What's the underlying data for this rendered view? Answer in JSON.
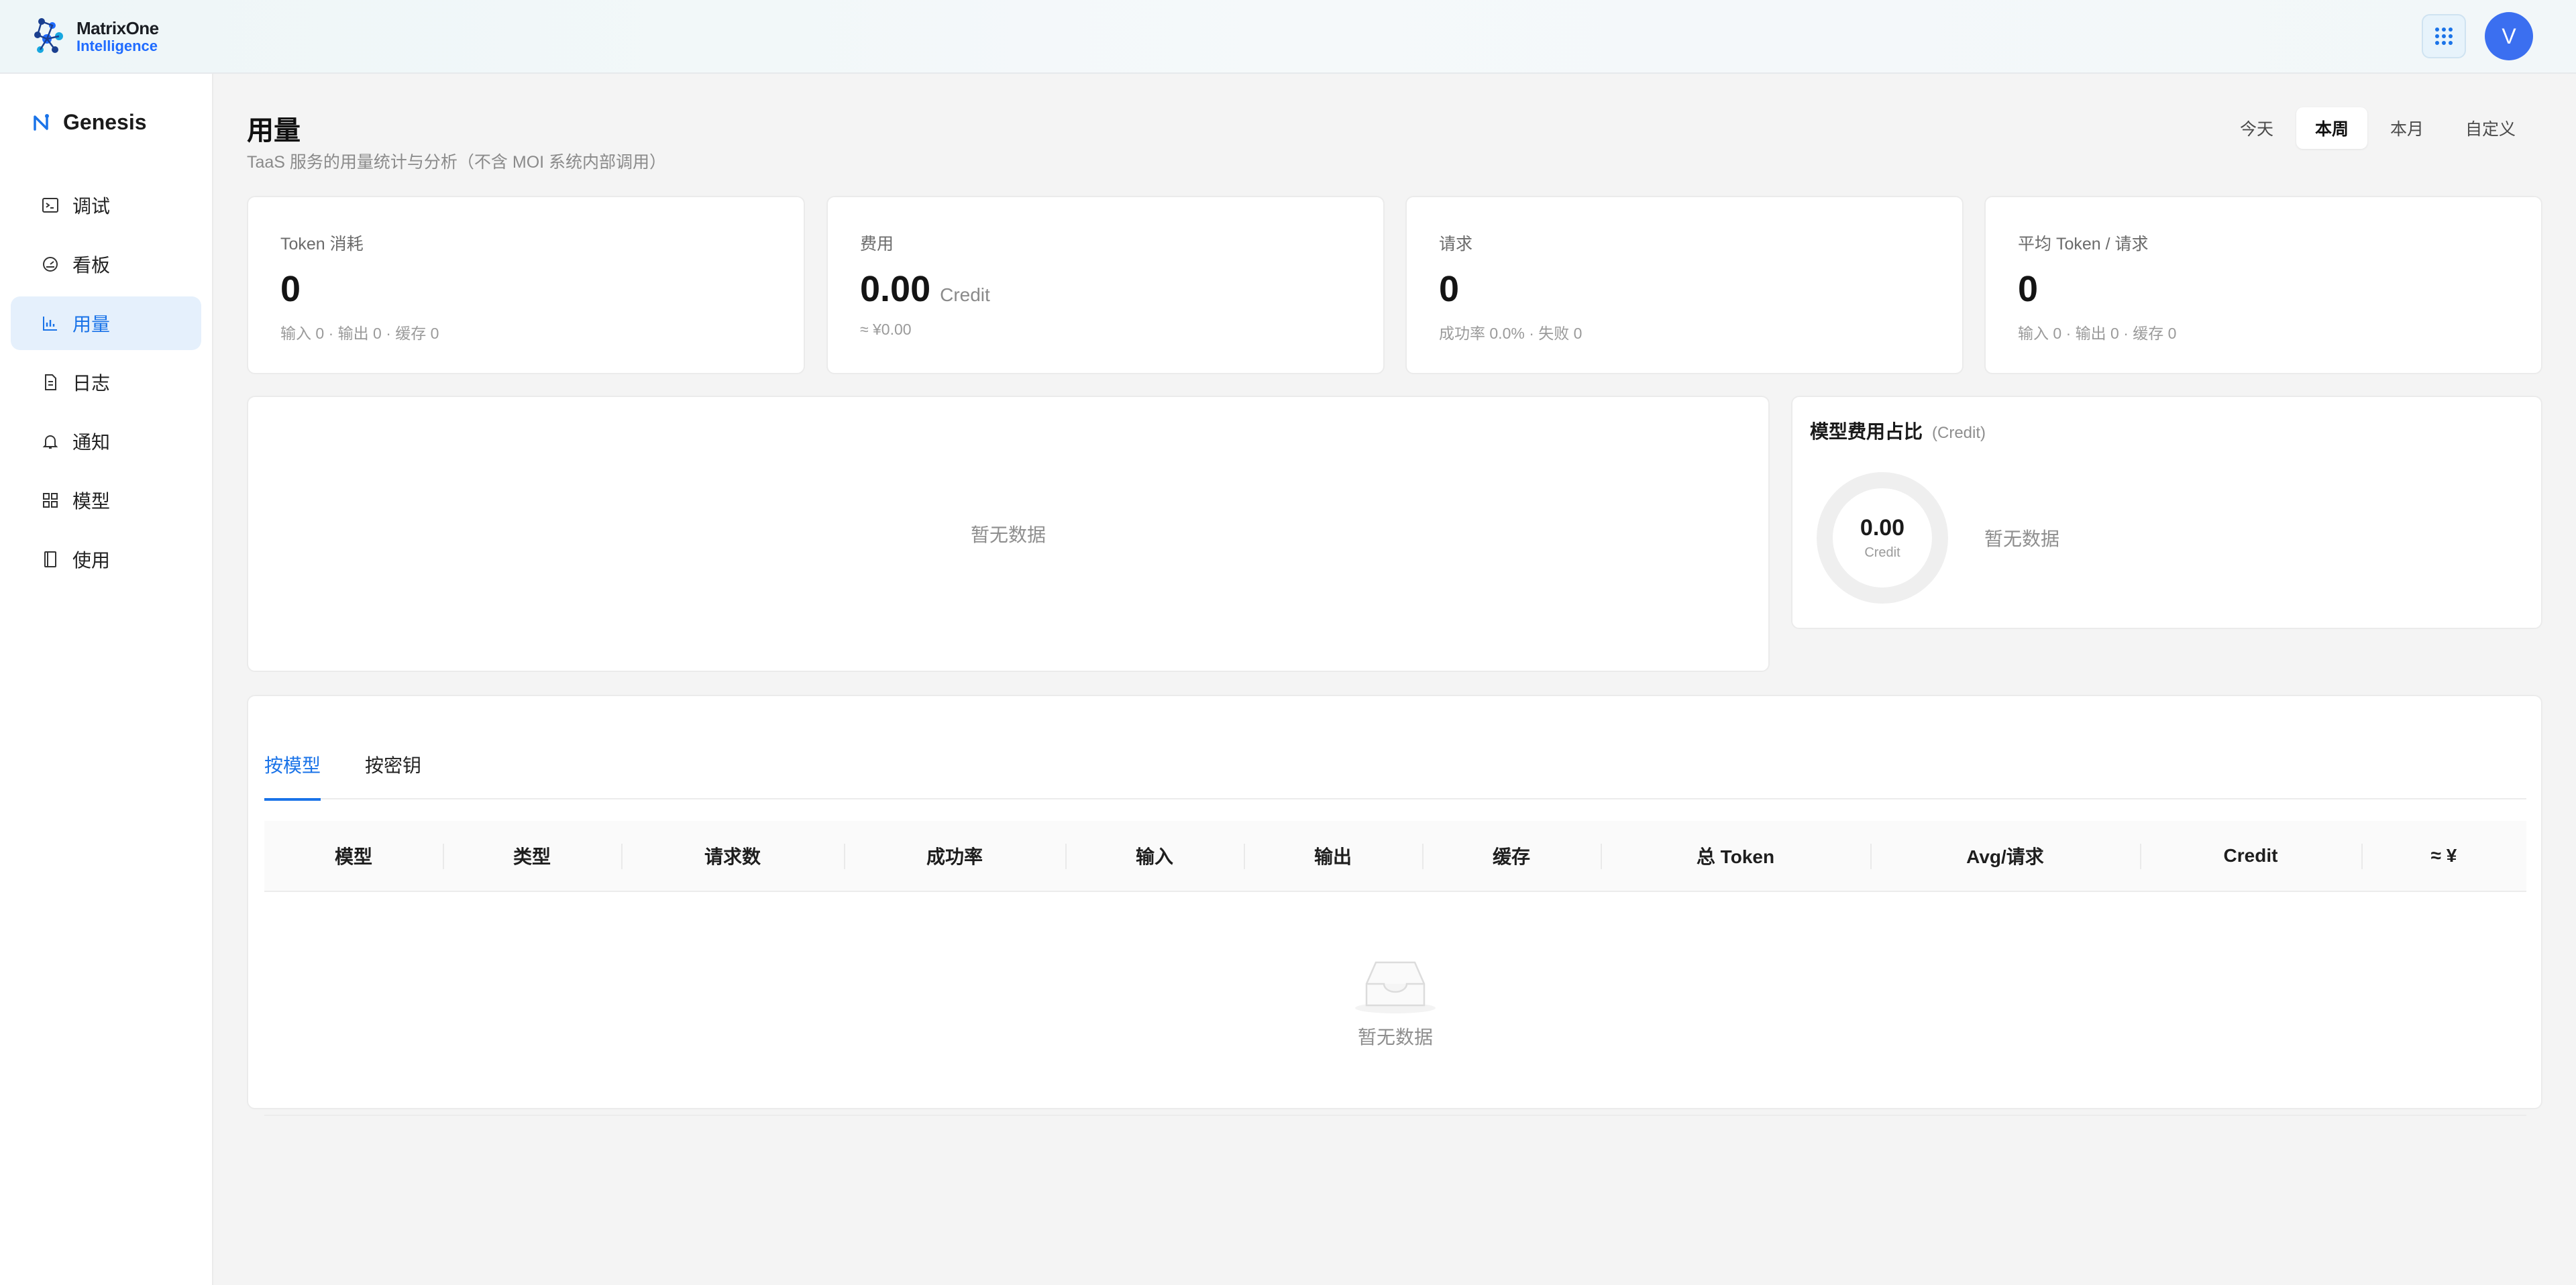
{
  "brand": {
    "line1": "MatrixOne",
    "line2": "Intelligence"
  },
  "user": {
    "avatar_letter": "V"
  },
  "sidebar": {
    "app_name": "Genesis",
    "items": [
      {
        "label": "调试",
        "icon": "terminal-icon",
        "active": false
      },
      {
        "label": "看板",
        "icon": "gauge-icon",
        "active": false
      },
      {
        "label": "用量",
        "icon": "bar-chart-icon",
        "active": true
      },
      {
        "label": "日志",
        "icon": "document-icon",
        "active": false
      },
      {
        "label": "通知",
        "icon": "bell-icon",
        "active": false
      },
      {
        "label": "模型",
        "icon": "grid-icon",
        "active": false
      },
      {
        "label": "使用",
        "icon": "book-icon",
        "active": false
      }
    ]
  },
  "page": {
    "title": "用量",
    "subtitle": "TaaS 服务的用量统计与分析（不含 MOI 系统内部调用）"
  },
  "range": {
    "options": [
      "今天",
      "本周",
      "本月",
      "自定义"
    ],
    "selected": "本周"
  },
  "stats": [
    {
      "label": "Token 消耗",
      "value": "0",
      "unit": "",
      "sub": "输入 0 · 输出 0 · 缓存 0"
    },
    {
      "label": "费用",
      "value": "0.00",
      "unit": "Credit",
      "sub": "≈ ¥0.00"
    },
    {
      "label": "请求",
      "value": "0",
      "unit": "",
      "sub": "成功率 0.0% · 失败 0"
    },
    {
      "label": "平均 Token / 请求",
      "value": "0",
      "unit": "",
      "sub": "输入 0 · 输出 0 · 缓存 0"
    }
  ],
  "trend_chart": {
    "empty_text": "暂无数据"
  },
  "model_share": {
    "title": "模型费用占比",
    "unit": "(Credit)",
    "total": "0.00",
    "total_unit": "Credit",
    "empty_text": "暂无数据"
  },
  "table": {
    "tabs": [
      "按模型",
      "按密钥"
    ],
    "active_tab": "按模型",
    "columns": [
      "模型",
      "类型",
      "请求数",
      "成功率",
      "输入",
      "输出",
      "缓存",
      "总 Token",
      "Avg/请求",
      "Credit",
      "≈ ¥"
    ],
    "rows": [],
    "empty_text": "暂无数据"
  },
  "colors": {
    "accent": "#1a73e8",
    "avatar": "#3b6ff0",
    "active_nav_bg": "#e5f0fc"
  }
}
